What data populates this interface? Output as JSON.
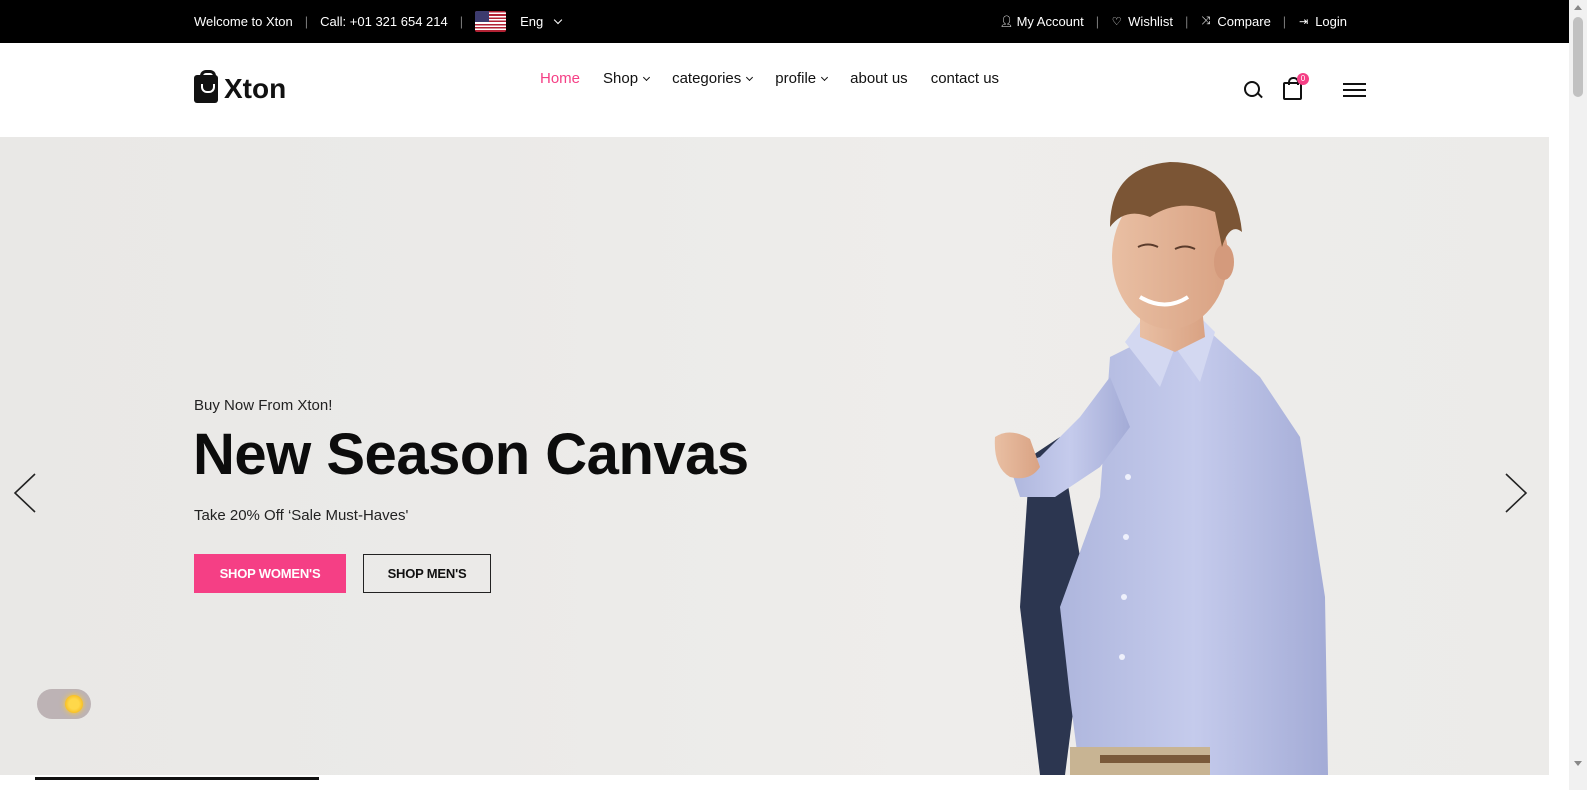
{
  "topbar": {
    "welcome": "Welcome to Xton",
    "phone": "Call: +01 321 654 214",
    "language": "Eng",
    "my_account": "My Account",
    "wishlist": "Wishlist",
    "compare": "Compare",
    "login": "Login"
  },
  "header": {
    "logo": "Xton",
    "nav": [
      {
        "label": "Home",
        "active": true
      },
      {
        "label": "Shop",
        "dropdown": true
      },
      {
        "label": "categories",
        "dropdown": true
      },
      {
        "label": "profile",
        "dropdown": true
      },
      {
        "label": "about us"
      },
      {
        "label": "contact us"
      }
    ],
    "cart_count": "0"
  },
  "hero": {
    "subtitle": "Buy Now From Xton!",
    "title": "New Season Canvas",
    "description": "Take 20% Off ‘Sale Must-Haves'",
    "btn_women": "SHOP WOMEN'S",
    "btn_men": "SHOP MEN'S"
  },
  "colors": {
    "accent": "#f53f85",
    "topbar_bg": "#000000",
    "hero_bg": "#ebeae8"
  }
}
